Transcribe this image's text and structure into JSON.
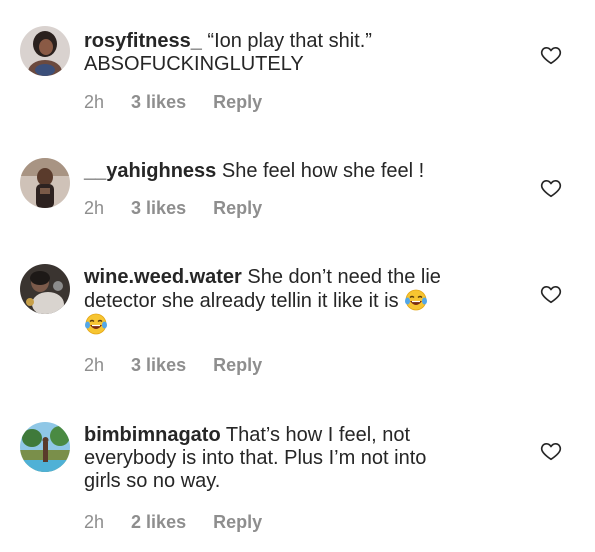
{
  "comments": [
    {
      "username": "rosyfitness_",
      "lines": [
        "“Ion play that shit.”",
        "ABSOFUCKINGLUTELY"
      ],
      "time": "2h",
      "likes": "3 likes",
      "reply": "Reply",
      "avatar_icon": "profile-photo"
    },
    {
      "username": "__yahighness",
      "lines": [
        "She feel how she feel !"
      ],
      "time": "2h",
      "likes": "3 likes",
      "reply": "Reply",
      "avatar_icon": "profile-photo"
    },
    {
      "username": "wine.weed.water",
      "lines": [
        "She don’t need the lie",
        "detector she already tellin it like it is"
      ],
      "emoji_name": "face-with-tears-of-joy",
      "time": "2h",
      "likes": "3 likes",
      "reply": "Reply",
      "avatar_icon": "profile-photo"
    },
    {
      "username": "bimbimnagato",
      "lines": [
        "That’s how I feel, not",
        "everybody is into that. Plus I’m not into",
        "girls so no way."
      ],
      "time": "2h",
      "likes": "2 likes",
      "reply": "Reply",
      "avatar_icon": "profile-photo"
    }
  ],
  "icons": {
    "like": "heart-outline-icon"
  },
  "colors": {
    "text": "#262626",
    "meta": "#8e8e8e"
  }
}
